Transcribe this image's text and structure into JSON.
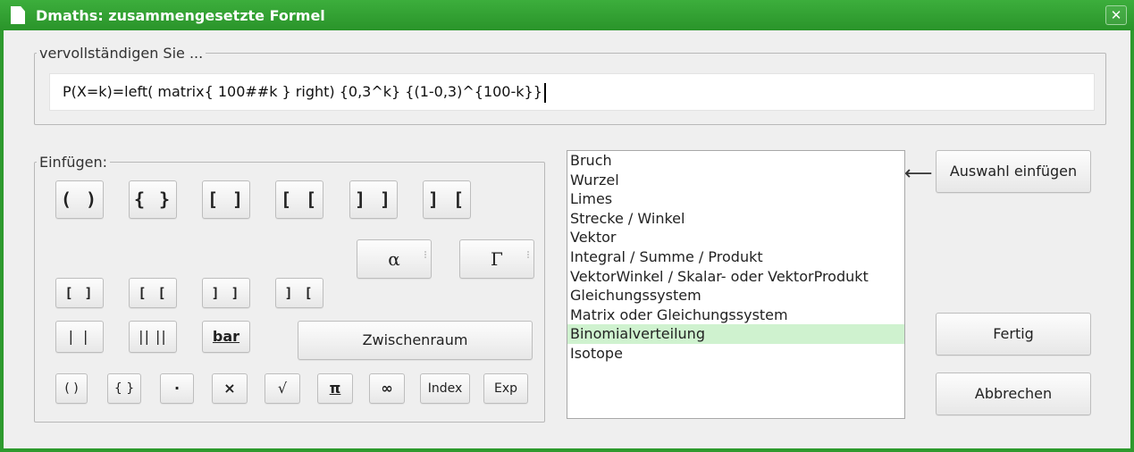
{
  "window": {
    "title": "Dmaths: zusammengesetzte Formel",
    "close_glyph": "✕"
  },
  "formula_group": {
    "legend": "vervollständigen Sie ..."
  },
  "formula": {
    "value": "P(X=k)=left( matrix{ 100##k } right) {0,3^k} {(1-0,3)^{100-k}}"
  },
  "insert_group": {
    "legend": "Einfügen:"
  },
  "buttons": {
    "row1": [
      "( )",
      "{ }",
      "[ ]",
      "[ [",
      "] ]",
      "] ["
    ],
    "alpha": "α",
    "gamma": "Γ",
    "row2": [
      "[ ]",
      "[ [",
      "] ]",
      "] ["
    ],
    "abs": "| |",
    "norm": "|| ||",
    "bar": "bar",
    "space": "Zwischenraum",
    "row4": [
      "( )",
      "{ }",
      "·",
      "×",
      "√",
      "π",
      "∞"
    ],
    "index": "Index",
    "exp": "Exp"
  },
  "list": {
    "items": [
      "Bruch",
      "Wurzel",
      "Limes",
      "Strecke / Winkel",
      "Vektor",
      "Integral / Summe / Produkt",
      "VektorWinkel / Skalar- oder VektorProdukt",
      "Gleichungssystem",
      "Matrix oder Gleichungssystem",
      "Binomialverteilung",
      "Isotope"
    ],
    "selected_index": 9,
    "selected_color": "#cff2cf"
  },
  "arrow": "⟵",
  "actions": {
    "insert_selection": "Auswahl einfügen",
    "done": "Fertig",
    "cancel": "Abbrechen"
  },
  "theme": {
    "titlebar_color": "#2e9a2e"
  }
}
